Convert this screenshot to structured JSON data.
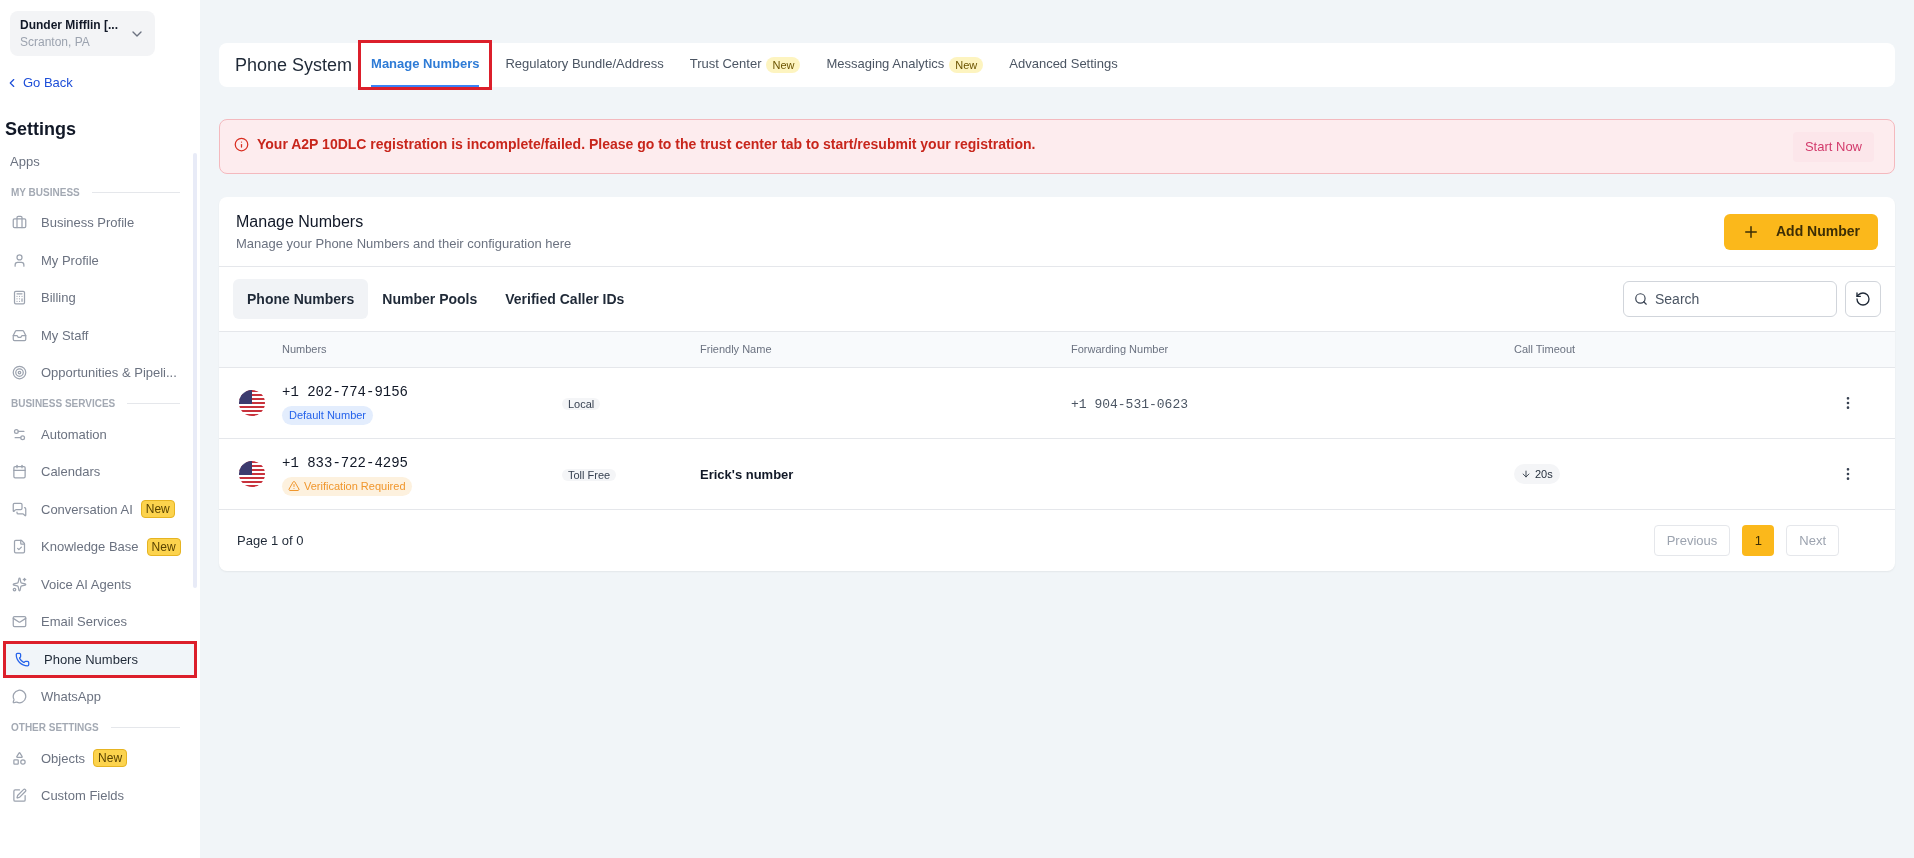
{
  "sidebar": {
    "org_name": "Dunder Mifflin [...",
    "org_location": "Scranton, PA",
    "back_label": "Go Back",
    "title": "Settings",
    "sections": [
      {
        "items": [
          {
            "label": "Apps",
            "selected": false,
            "highlighted": false
          }
        ]
      },
      {
        "heading": "MY BUSINESS",
        "items": [
          {
            "label": "Business Profile",
            "selected": false,
            "highlighted": false
          },
          {
            "label": "My Profile",
            "selected": false,
            "highlighted": false
          },
          {
            "label": "Billing",
            "selected": false,
            "highlighted": false
          },
          {
            "label": "My Staff",
            "selected": false,
            "highlighted": false
          },
          {
            "label": "Opportunities & Pipeli...",
            "selected": false,
            "highlighted": false
          }
        ]
      },
      {
        "heading": "BUSINESS SERVICES",
        "items": [
          {
            "label": "Automation",
            "selected": false,
            "highlighted": false
          },
          {
            "label": "Calendars",
            "selected": false,
            "highlighted": false
          },
          {
            "label": "Conversation AI",
            "badge": "New",
            "selected": false,
            "highlighted": false
          },
          {
            "label": "Knowledge Base",
            "badge": "New",
            "selected": false,
            "highlighted": false
          },
          {
            "label": "Voice AI Agents",
            "selected": false,
            "highlighted": false
          },
          {
            "label": "Email Services",
            "selected": false,
            "highlighted": false
          },
          {
            "label": "Phone Numbers",
            "selected": true,
            "highlighted": true
          },
          {
            "label": "WhatsApp",
            "selected": false,
            "highlighted": false
          }
        ]
      },
      {
        "heading": "OTHER SETTINGS",
        "items": [
          {
            "label": "Objects",
            "badge": "New",
            "selected": false,
            "highlighted": false
          },
          {
            "label": "Custom Fields",
            "selected": false,
            "highlighted": false
          }
        ]
      }
    ]
  },
  "top_bar": {
    "title": "Phone System",
    "tabs": [
      {
        "label": "Manage Numbers",
        "selected": true,
        "highlighted": true
      },
      {
        "label": "Regulatory Bundle/Address",
        "selected": false,
        "highlighted": false
      },
      {
        "label": "Trust Center",
        "badge": "New",
        "selected": false,
        "highlighted": false
      },
      {
        "label": "Messaging Analytics",
        "badge": "New",
        "selected": false,
        "highlighted": false
      },
      {
        "label": "Advanced Settings",
        "selected": false,
        "highlighted": false
      }
    ]
  },
  "alert": {
    "message": "Your A2P 10DLC registration is incomplete/failed. Please go to the trust center tab to start/resubmit your registration.",
    "action": "Start Now"
  },
  "card": {
    "title": "Manage Numbers",
    "subtitle": "Manage your Phone Numbers and their configuration here",
    "add_button": "Add Number",
    "tabs": [
      {
        "label": "Phone Numbers",
        "selected": true
      },
      {
        "label": "Number Pools",
        "selected": false
      },
      {
        "label": "Verified Caller IDs",
        "selected": false
      }
    ],
    "search": {
      "placeholder": "Search"
    },
    "table": {
      "columns": [
        "Numbers",
        "Friendly Name",
        "Forwarding Number",
        "Call Timeout"
      ],
      "rows": [
        {
          "number": "+1 202-774-9156",
          "status": {
            "kind": "default",
            "label": "Default Number"
          },
          "type": "Local",
          "forwarding_number": "+1 904-531-0623"
        },
        {
          "number": "+1 833-722-4295",
          "status": {
            "kind": "warning",
            "label": "Verification Required"
          },
          "type": "Toll Free",
          "friendly_name": "Erick's number",
          "call_timeout": "20s"
        }
      ]
    },
    "footer": {
      "page_text": "Page 1 of 0",
      "previous": {
        "label": "Previous",
        "disabled": true
      },
      "pages": [
        {
          "label": "1",
          "selected": true
        }
      ],
      "next": {
        "label": "Next",
        "disabled": true
      }
    }
  }
}
